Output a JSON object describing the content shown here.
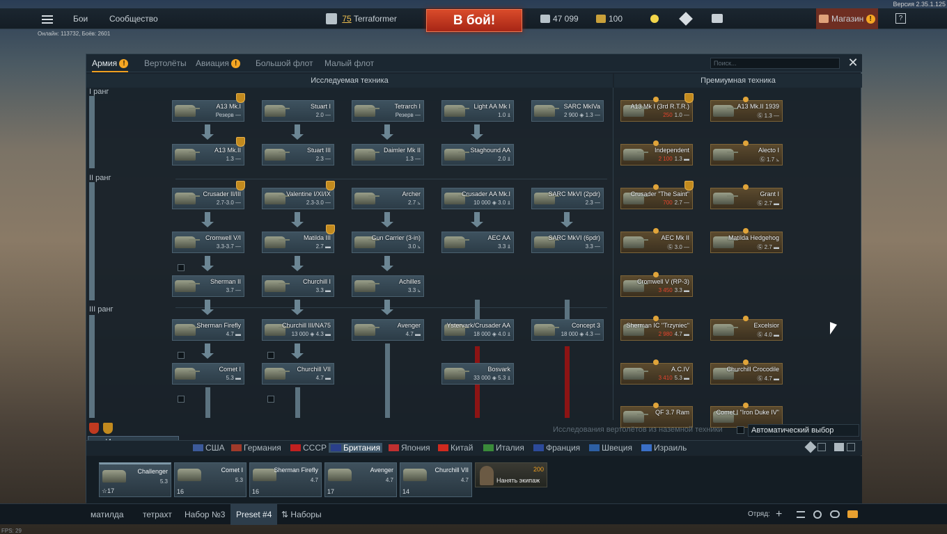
{
  "version": "Версия 2.35.1.125",
  "online": "Онлайн: 113732, Боёв: 2601",
  "topbar": {
    "battles": "Бои",
    "community": "Сообщество",
    "player_level": "75",
    "player_name": "Terraformer",
    "to_battle": "В бой!",
    "silver": "47 099",
    "gold": "100",
    "shop": "Магазин",
    "help": "?"
  },
  "tabs": [
    {
      "label": "Армия",
      "warn": "!"
    },
    {
      "label": "Вертолёты"
    },
    {
      "label": "Авиация",
      "warn": "!"
    },
    {
      "label": "Большой флот"
    },
    {
      "label": "Малый флот"
    }
  ],
  "search_placeholder": "Поиск...",
  "close": "✕",
  "sections": {
    "researched": "Исследуемая техника",
    "premium": "Премиумная техника"
  },
  "ranks": [
    "I ранг",
    "II ранг",
    "III ранг"
  ],
  "tree": [
    {
      "name": "A13 Mk.I",
      "stat": "Резерв —",
      "badge": true
    },
    {
      "name": "Stuart I",
      "stat": "2.0 —"
    },
    {
      "name": "Tetrarch I",
      "stat": "Резерв —"
    },
    {
      "name": "Light AA Mk I",
      "stat": "1.0 ⫫"
    },
    {
      "name": "SARC MkIVa",
      "stat": "2 900 ◈ 1.3 —"
    },
    {
      "name": "A13 Mk.II",
      "stat": "1.3 —",
      "badge": true
    },
    {
      "name": "Stuart III",
      "stat": "2.3 —"
    },
    {
      "name": "Daimler Mk II",
      "stat": "1.3 —"
    },
    {
      "name": "Staghound AA",
      "stat": "2.0 ⫫"
    },
    {
      "name": "Crusader II/III",
      "stat": "2.7-3.0 —",
      "badge": true
    },
    {
      "name": "Valentine I/XI/IX",
      "stat": "2.3-3.0 —",
      "badge": true
    },
    {
      "name": "Archer",
      "stat": "2.7 ⦣"
    },
    {
      "name": "Crusader AA Mk.I",
      "stat": "10 000 ◈ 3.0 ⫫"
    },
    {
      "name": "SARC MkVI (2pdr)",
      "stat": "2.3 —"
    },
    {
      "name": "Cromwell V/I",
      "stat": "3.3-3.7 —"
    },
    {
      "name": "Matilda III",
      "stat": "2.7 ▬",
      "badge": true
    },
    {
      "name": "Gun Carrier (3-in)",
      "stat": "3.0 ⦣"
    },
    {
      "name": "AEC AA",
      "stat": "3.3 ⫫"
    },
    {
      "name": "SARC MkVI (6pdr)",
      "stat": "3.3 —"
    },
    {
      "name": "Sherman II",
      "stat": "3.7 —"
    },
    {
      "name": "Churchill I",
      "stat": "3.3 ▬"
    },
    {
      "name": "Achilles",
      "stat": "3.3 ⦣"
    },
    {
      "name": "Sherman Firefly",
      "stat": "4.7 ▬"
    },
    {
      "name": "Churchill III/NA75",
      "stat": "13 000 ◈ 4.3 ▬"
    },
    {
      "name": "Avenger",
      "stat": "4.7 ▬"
    },
    {
      "name": "Ystervark/Crusader AA",
      "stat": "18 000 ◈ 4.0 ⫫"
    },
    {
      "name": "Concept 3",
      "stat": "18 000 ◈ 4.3 —"
    },
    {
      "name": "Comet I",
      "stat": "5.3 ▬"
    },
    {
      "name": "Churchill VII",
      "stat": "4.7 ▬"
    },
    {
      "name": "Bosvark",
      "stat": "33 000 ◈ 5.3 ⫫"
    }
  ],
  "premium": [
    {
      "name": "A13 Mk I (3rd R.T.R.)",
      "price": "250",
      "stat": "1.0 —",
      "badge": true
    },
    {
      "name": "A13 Mk.II 1939",
      "price": "",
      "stat": "Ⓖ 1.3 —"
    },
    {
      "name": "Independent",
      "price": "2 100",
      "stat": "1.3 ▬"
    },
    {
      "name": "Alecto I",
      "price": "",
      "stat": "Ⓖ 1.7 ⦣"
    },
    {
      "name": "Crusader \"The Saint\"",
      "price": "700",
      "stat": "2.7 —",
      "badge": true
    },
    {
      "name": "Grant I",
      "price": "",
      "stat": "Ⓖ 2.7 ▬"
    },
    {
      "name": "AEC Mk II",
      "price": "",
      "stat": "Ⓖ 3.0 —"
    },
    {
      "name": "Matilda Hedgehog",
      "price": "",
      "stat": "Ⓖ 2.7 ▬"
    },
    {
      "name": "Cromwell V (RP-3)",
      "price": "3 450",
      "stat": "3.3 ▬"
    },
    {
      "name": "Sherman IC \"Trzyniec\"",
      "price": "2 980",
      "stat": "4.7 ▬"
    },
    {
      "name": "Excelsior",
      "price": "",
      "stat": "Ⓖ 4.0 ▬"
    },
    {
      "name": "A.C.IV",
      "price": "3 410",
      "stat": "5.3 ▬"
    },
    {
      "name": "Churchill Crocodile",
      "price": "",
      "stat": "Ⓖ 4.7 ▬"
    },
    {
      "name": "QF 3.7 Ram",
      "price": "",
      "stat": ""
    },
    {
      "name": "Comet I \"Iron Duke IV\"",
      "price": "",
      "stat": ""
    }
  ],
  "auto_label": "Исследования вертолётов из наземной техники",
  "auto_select": "Автоматический выбор",
  "research_tab": "Исследования",
  "countries": [
    {
      "label": "США",
      "color": "#3c5a9a"
    },
    {
      "label": "Германия",
      "color": "#a03a2a"
    },
    {
      "label": "СССР",
      "color": "#c02020"
    },
    {
      "label": "Британия",
      "color": "#2a3f8a",
      "active": true
    },
    {
      "label": "Япония",
      "color": "#c03030"
    },
    {
      "label": "Китай",
      "color": "#d02a1f"
    },
    {
      "label": "Италия",
      "color": "#3a8a3a"
    },
    {
      "label": "Франция",
      "color": "#2c4a9a"
    },
    {
      "label": "Швеция",
      "color": "#2d5fa3"
    },
    {
      "label": "Израиль",
      "color": "#3a6fc7"
    }
  ],
  "crew": [
    {
      "name": "Challenger",
      "br": "5.3",
      "lvl": "☆17"
    },
    {
      "name": "Comet I",
      "br": "5.3",
      "lvl": "16"
    },
    {
      "name": "Sherman Firefly",
      "br": "4.7",
      "lvl": "16"
    },
    {
      "name": "Avenger",
      "br": "4.7",
      "lvl": "17"
    },
    {
      "name": "Churchill VII",
      "br": "4.7",
      "lvl": "14"
    }
  ],
  "hire": {
    "label": "Нанять экипаж",
    "price": "200"
  },
  "presets": [
    "матилда",
    "тетрахт",
    "Набор №3",
    "Preset #4",
    "Наборы"
  ],
  "squad_label": "Отряд:",
  "fps": "FPS: 29"
}
